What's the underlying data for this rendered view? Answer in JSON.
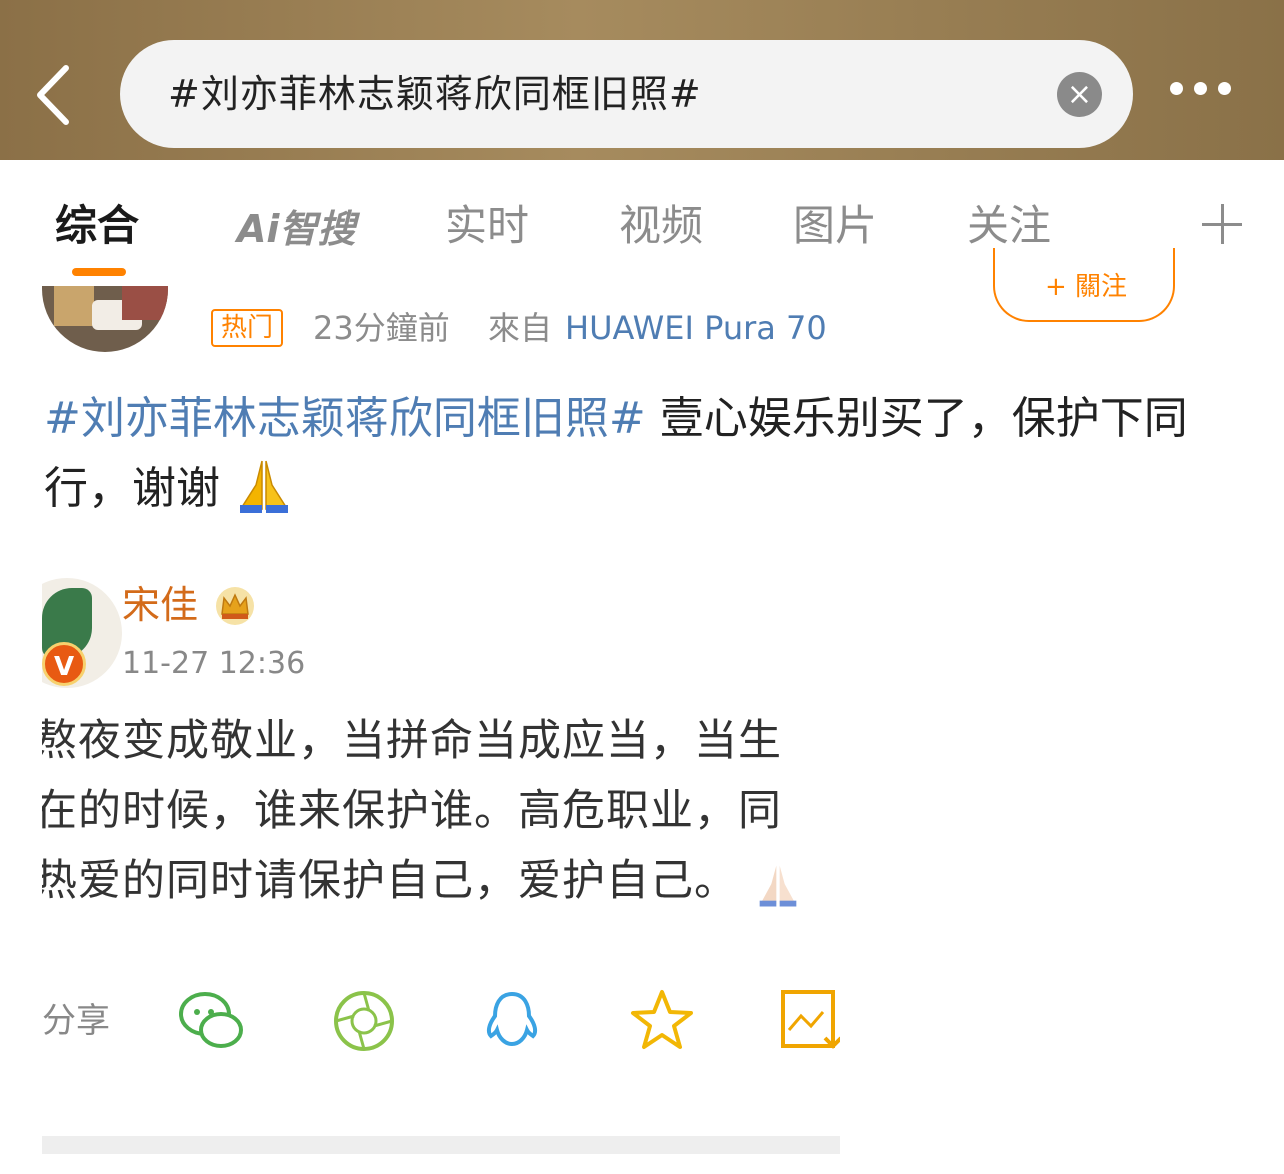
{
  "search": {
    "query": "#刘亦菲林志颖蒋欣同框旧照#"
  },
  "tabs": [
    {
      "label": "综合",
      "active": true
    },
    {
      "label": "Ai智搜",
      "active": false
    },
    {
      "label": "实时",
      "active": false
    },
    {
      "label": "视频",
      "active": false
    },
    {
      "label": "图片",
      "active": false
    },
    {
      "label": "关注",
      "active": false
    }
  ],
  "post": {
    "badge": "热门",
    "time": "23分鐘前",
    "from_label": "來自",
    "device": "HUAWEI Pura 70",
    "follow_label": "+ 關注",
    "hashtag": "#刘亦菲林志颖蒋欣同框旧照#",
    "text": " 壹心娱乐别买了，保护下同行，谢谢",
    "emoji": "pray-emoji"
  },
  "embedded": {
    "name": "宋佳",
    "date": "11-27 12:36",
    "lines": [
      "熬夜变成敬业，当拼命当成应当，当生",
      "在的时候，谁来保护谁。高危职业，同",
      "热爱的同时请保护自己，爱护自己。"
    ],
    "share_label": "分享",
    "share_icons": [
      "wechat-icon",
      "moments-icon",
      "qq-icon",
      "qzone-icon",
      "save-image-icon"
    ]
  },
  "colors": {
    "accent": "#ff8200",
    "link": "#4f7db3",
    "topbar": "#8b7047"
  }
}
